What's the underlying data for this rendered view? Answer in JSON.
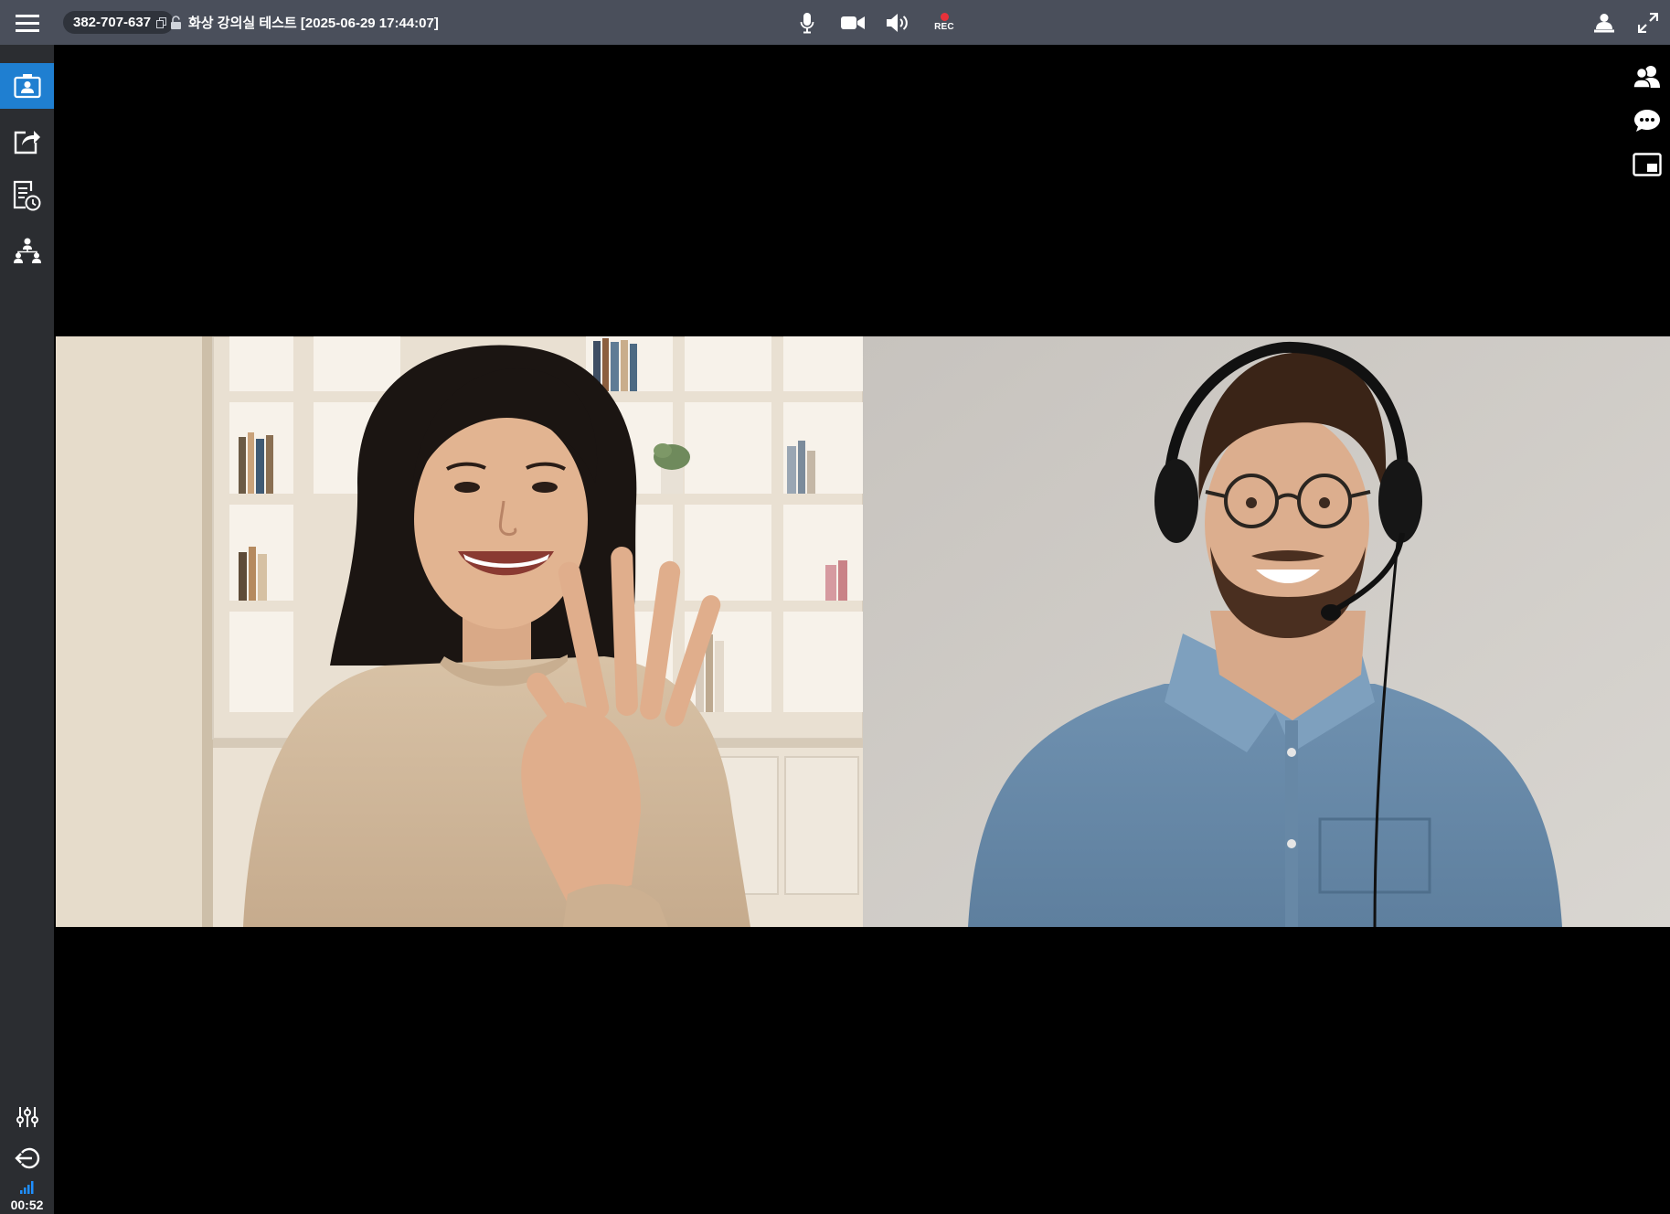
{
  "topbar": {
    "room_id": "382-707-637",
    "room_title": "화상 강의실 테스트 [2025-06-29 17:44:07]",
    "controls": {
      "mic_icon": "microphone-icon",
      "camera_icon": "video-camera-icon",
      "speaker_icon": "speaker-icon",
      "record_label": "REC"
    },
    "right": {
      "presenter_icon": "presenter-icon",
      "fullscreen_icon": "expand-icon"
    }
  },
  "sidebar": {
    "items": [
      {
        "name": "webcam",
        "icon": "webcam-icon",
        "active": true
      },
      {
        "name": "share",
        "icon": "share-icon",
        "active": false
      },
      {
        "name": "attendance",
        "icon": "attendance-clock-icon",
        "active": false
      },
      {
        "name": "organization",
        "icon": "group-hierarchy-icon",
        "active": false
      }
    ],
    "bottom": [
      {
        "name": "settings",
        "icon": "sliders-icon"
      },
      {
        "name": "exit",
        "icon": "exit-icon"
      }
    ],
    "status": {
      "signal_icon": "signal-bars-icon",
      "timer": "00:52"
    }
  },
  "right_rail": [
    {
      "name": "participants",
      "icon": "participants-icon"
    },
    {
      "name": "chat",
      "icon": "chat-bubble-icon"
    },
    {
      "name": "pip",
      "icon": "picture-in-picture-icon"
    }
  ],
  "video_tiles": [
    {
      "name": "participant-1",
      "description_icon": "video-feed"
    },
    {
      "name": "participant-2",
      "description_icon": "video-feed"
    }
  ],
  "colors": {
    "topbar": "#4a4f5b",
    "sidebar": "#2b2d31",
    "accent": "#1f7fd1",
    "record": "#e8313a",
    "stage": "#000000"
  }
}
